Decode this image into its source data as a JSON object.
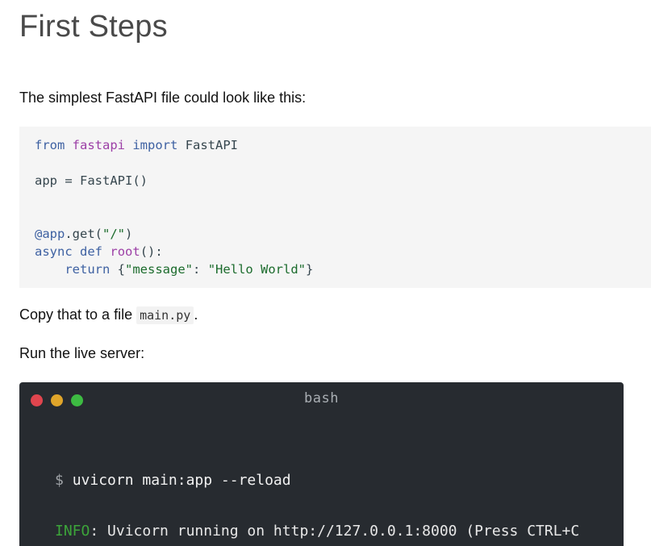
{
  "page": {
    "title": "First Steps",
    "intro_text": "The simplest FastAPI file could look like this:",
    "copy_prefix": "Copy that to a file ",
    "copy_filename": "main.py",
    "copy_suffix": ".",
    "run_text": "Run the live server:"
  },
  "code": {
    "line1": {
      "kw_from": "from",
      "module": "fastapi",
      "kw_import": "import",
      "name": "FastAPI"
    },
    "line2": {
      "text": "app = FastAPI()"
    },
    "line3": {
      "decorator": "@app",
      "rest": ".get(",
      "path": "\"/\"",
      "close": ")"
    },
    "line4": {
      "kw_async": "async",
      "kw_def": "def",
      "fn": "root",
      "rest": "():"
    },
    "line5": {
      "kw_return": "return",
      "open": "{",
      "key": "\"message\"",
      "colon": ": ",
      "value": "\"Hello World\"",
      "close": "}"
    }
  },
  "terminal": {
    "title": "bash",
    "prompt": "$",
    "command": "uvicorn main:app --reload",
    "info_label": "INFO",
    "info_text": ": Uvicorn running on http://127.0.0.1:8000 (Press CTRL+C"
  },
  "colors": {
    "keyword": "#3e61a2",
    "module": "#9c3fa6",
    "string": "#1b6b2c",
    "terminal_bg": "#272b30",
    "info": "#3ca53a"
  }
}
